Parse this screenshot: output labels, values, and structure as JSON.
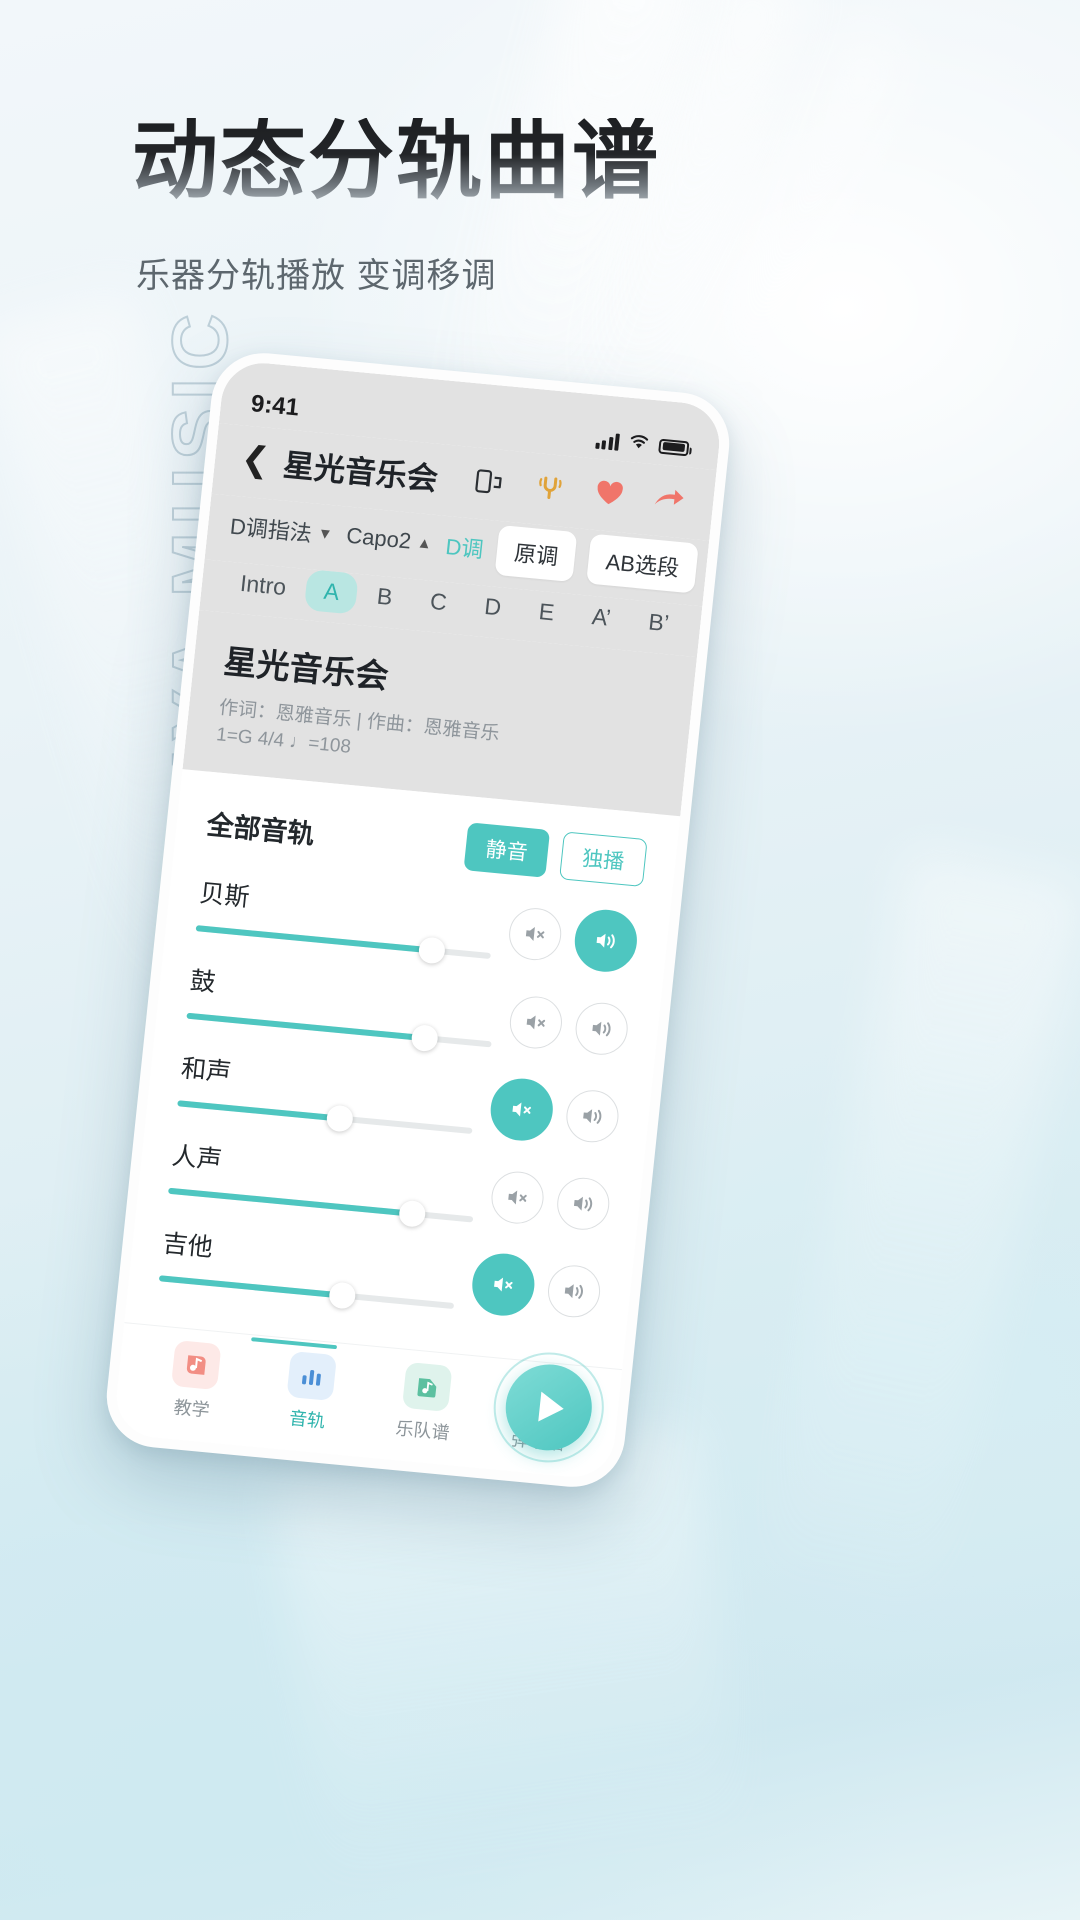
{
  "promo": {
    "headline": "动态分轨曲谱",
    "subhead": "乐器分轨播放 变调移调",
    "watermark": "ENYA MUSIC"
  },
  "colors": {
    "accent": "#4ec6c0",
    "accent_text": "#2fb4ad",
    "chip_active_bg": "#b9e6e2",
    "tuner_icon": "#e0a33a",
    "heart_icon": "#f0756a",
    "share_icon": "#f0756a",
    "title_gradient_top": "#1d1f22",
    "title_gradient_bottom": "#aab2b8",
    "screen_header_bg": "#e2e2e2"
  },
  "statusbar": {
    "time": "9:41",
    "signal_icon": "signal-bars-icon",
    "wifi_icon": "wifi-icon",
    "battery_icon": "battery-icon"
  },
  "navbar": {
    "back_icon": "chevron-left-icon",
    "title": "星光音乐会",
    "icons": [
      {
        "name": "screen-rotate-icon"
      },
      {
        "name": "tuning-fork-icon"
      },
      {
        "name": "heart-icon"
      },
      {
        "name": "share-icon"
      }
    ]
  },
  "toolbar": {
    "fingering": "D调指法",
    "fingering_caret": "▼",
    "capo": "Capo2",
    "capo_caret": "▲",
    "key_label": "D调",
    "original_key": "原调",
    "ab_select": "AB选段",
    "menu_icon": "sort-lines-icon"
  },
  "section_tabs": {
    "intro_label": "Intro",
    "items": [
      {
        "label": "A",
        "active": true
      },
      {
        "label": "B",
        "active": false
      },
      {
        "label": "C",
        "active": false
      },
      {
        "label": "D",
        "active": false
      },
      {
        "label": "E",
        "active": false
      },
      {
        "label": "A’",
        "active": false
      },
      {
        "label": "B’",
        "active": false
      }
    ]
  },
  "song": {
    "title": "星光音乐会",
    "credits": "作词：恩雅音乐  |  作曲：恩雅音乐",
    "key_tempo": "1=G 4/4  ♩=108"
  },
  "tracks_panel": {
    "title": "全部音轨",
    "mute_all_label": "静音",
    "solo_label": "独播",
    "tracks": [
      {
        "name": "贝斯",
        "volume": 80,
        "mute_icon": "speaker-mute-icon",
        "mute_on": false,
        "solo_icon": "speaker-on-icon",
        "solo_on": true
      },
      {
        "name": "鼓",
        "volume": 78,
        "mute_icon": "speaker-mute-icon",
        "mute_on": false,
        "solo_icon": "speaker-on-icon",
        "solo_on": false
      },
      {
        "name": "和声",
        "volume": 55,
        "mute_icon": "speaker-mute-icon",
        "mute_on": true,
        "solo_icon": "speaker-on-icon",
        "solo_on": false
      },
      {
        "name": "人声",
        "volume": 80,
        "mute_icon": "speaker-mute-icon",
        "mute_on": false,
        "solo_icon": "speaker-on-icon",
        "solo_on": false
      },
      {
        "name": "吉他",
        "volume": 62,
        "mute_icon": "speaker-mute-icon",
        "mute_on": true,
        "solo_icon": "speaker-on-icon",
        "solo_on": false
      }
    ]
  },
  "tabbar": {
    "items": [
      {
        "label": "教学",
        "icon": "teaching-icon",
        "active": false
      },
      {
        "label": "音轨",
        "icon": "tracks-icon",
        "active": true
      },
      {
        "label": "乐队谱",
        "icon": "band-score-icon",
        "active": false
      },
      {
        "label": "弹唱谱",
        "icon": "sing-score-icon",
        "active": false
      }
    ],
    "play_button_icon": "play-icon"
  }
}
